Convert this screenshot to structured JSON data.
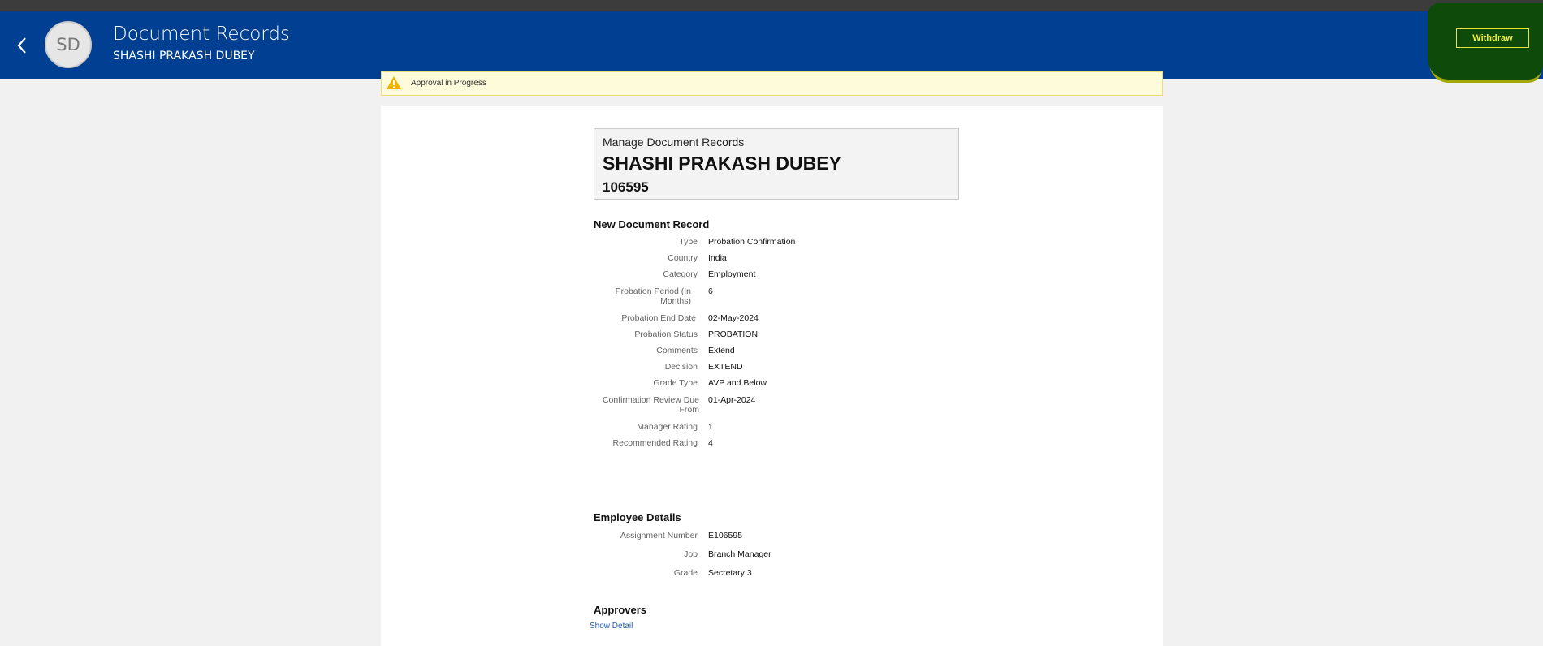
{
  "header": {
    "back_label": "Back",
    "avatar_initials": "SD",
    "title": "Document Records",
    "subtitle": "SHASHI PRAKASH DUBEY",
    "withdraw_label": "Withdraw"
  },
  "status_banner": {
    "text": "Approval in Progress"
  },
  "summary": {
    "label": "Manage Document Records",
    "name": "SHASHI PRAKASH DUBEY",
    "number": "106595"
  },
  "new_document": {
    "title": "New Document Record",
    "fields": [
      {
        "label": "Type",
        "value": "Probation Confirmation"
      },
      {
        "label": "Country",
        "value": "India"
      },
      {
        "label": "Category",
        "value": "Employment"
      },
      {
        "label": "Probation Period (In Months)",
        "value": "6"
      },
      {
        "label": "Probation End Date",
        "value": "02-May-2024"
      },
      {
        "label": "Probation Status",
        "value": "PROBATION"
      },
      {
        "label": "Comments",
        "value": "Extend"
      },
      {
        "label": "Decision",
        "value": "EXTEND"
      },
      {
        "label": "Grade Type",
        "value": "AVP and Below"
      },
      {
        "label": "Confirmation Review Due From",
        "value": "01-Apr-2024"
      },
      {
        "label": "Manager Rating",
        "value": "1"
      },
      {
        "label": "Recommended Rating",
        "value": "4"
      }
    ]
  },
  "employee_details": {
    "title": "Employee Details",
    "fields": [
      {
        "label": "Assignment Number",
        "value": "E106595"
      },
      {
        "label": "Job",
        "value": "Branch Manager"
      },
      {
        "label": "Grade",
        "value": "Secretary 3"
      }
    ]
  },
  "approvers": {
    "title": "Approvers",
    "show_detail": "Show Detail"
  }
}
